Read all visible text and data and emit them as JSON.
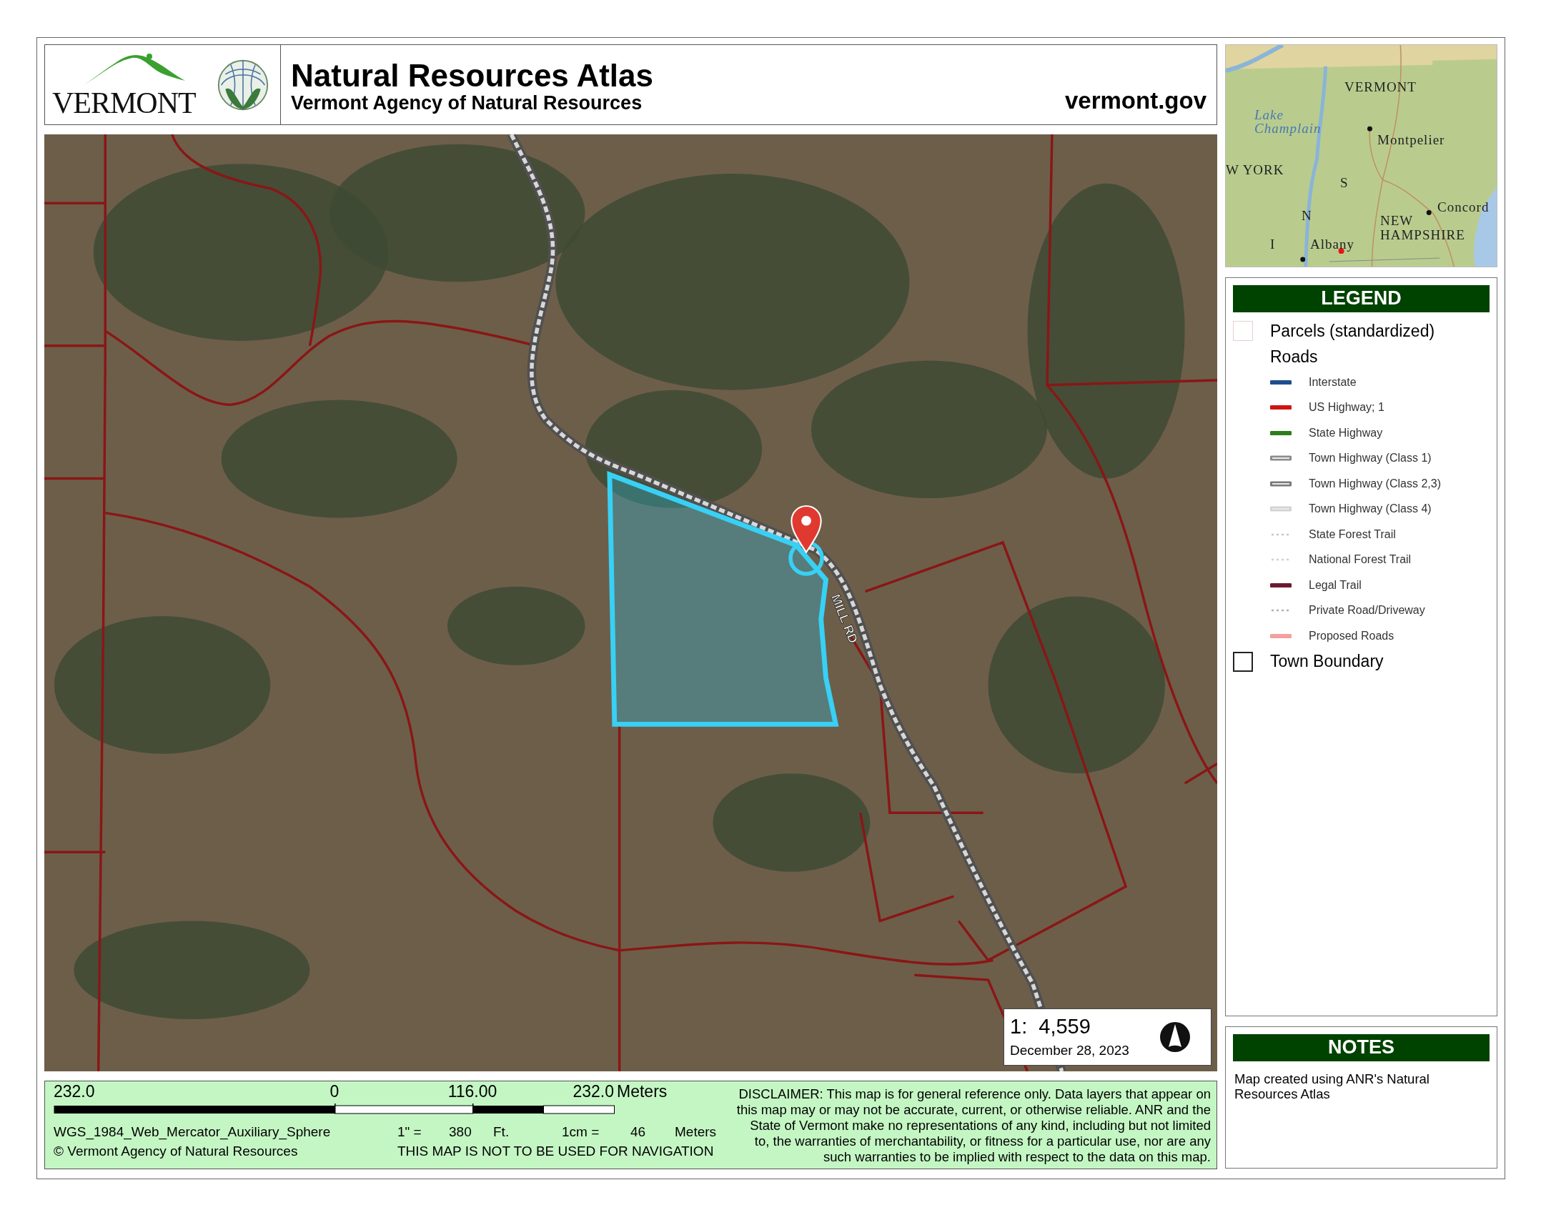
{
  "header": {
    "logo_text": "VERMONT",
    "title": "Natural Resources Atlas",
    "subtitle": "Vermont Agency of Natural Resources",
    "website": "vermont.gov"
  },
  "map": {
    "road_label": "MILL RD",
    "scale_ratio": "1:  4,559",
    "date": "December 28, 2023"
  },
  "inset_map": {
    "labels": [
      "VERMONT",
      "Lake Champlain",
      "Montpelier",
      "W YORK",
      "S",
      "N",
      "I",
      "Concord",
      "NEW HAMPSHIRE",
      "Albany"
    ]
  },
  "legend": {
    "title": "LEGEND",
    "items": [
      {
        "kind": "parcel-box",
        "label": "Parcels (standardized)"
      },
      {
        "kind": "heading",
        "label": "Roads"
      },
      {
        "kind": "line",
        "label": "Interstate",
        "color": "#1f4e8c"
      },
      {
        "kind": "line",
        "label": "US Highway; 1",
        "color": "#d01414"
      },
      {
        "kind": "line",
        "label": "State Highway",
        "color": "#2e7d1e"
      },
      {
        "kind": "cased-line",
        "label": "Town Highway (Class 1)",
        "color": "#8c8c8c"
      },
      {
        "kind": "cased-line",
        "label": "Town Highway (Class 2,3)",
        "color": "#7a7a7a"
      },
      {
        "kind": "cased-line",
        "label": "Town Highway (Class 4)",
        "color": "#d4d4d4"
      },
      {
        "kind": "dotted-line",
        "label": "State Forest Trail",
        "color": "#cfc6b4"
      },
      {
        "kind": "dotted-line",
        "label": "National Forest Trail",
        "color": "#d8d0c0"
      },
      {
        "kind": "line",
        "label": "Legal Trail",
        "color": "#6a1a30"
      },
      {
        "kind": "dotted-line",
        "label": "Private Road/Driveway",
        "color": "#b0b0b8"
      },
      {
        "kind": "line",
        "label": "Proposed Roads",
        "color": "#f4a0a0"
      },
      {
        "kind": "boundary-box",
        "label": "Town Boundary"
      }
    ]
  },
  "scale_bar": {
    "labels": [
      "232.0",
      "0",
      "116.00",
      "232.0"
    ],
    "unit": "Meters",
    "projection": "WGS_1984_Web_Mercator_Auxiliary_Sphere",
    "inch_label": "1\" =",
    "inch_value": "380",
    "inch_unit": "Ft.",
    "cm_label": "1cm =",
    "cm_value": "46",
    "cm_unit": "Meters",
    "copyright": "© Vermont Agency of Natural Resources",
    "navigation_warning": "THIS MAP IS NOT TO BE USED FOR NAVIGATION"
  },
  "disclaimer": "DISCLAIMER: This map is for general reference only. Data layers that appear on this map may or may not be accurate, current, or otherwise reliable. ANR and the State of Vermont make no representations of any kind, including but not limited to, the warranties of merchantability, or fitness for a particular use, nor are any such warranties to be implied with respect to the data on this map.",
  "notes": {
    "title": "NOTES",
    "text": "Map created using ANR's Natural Resources Atlas"
  }
}
